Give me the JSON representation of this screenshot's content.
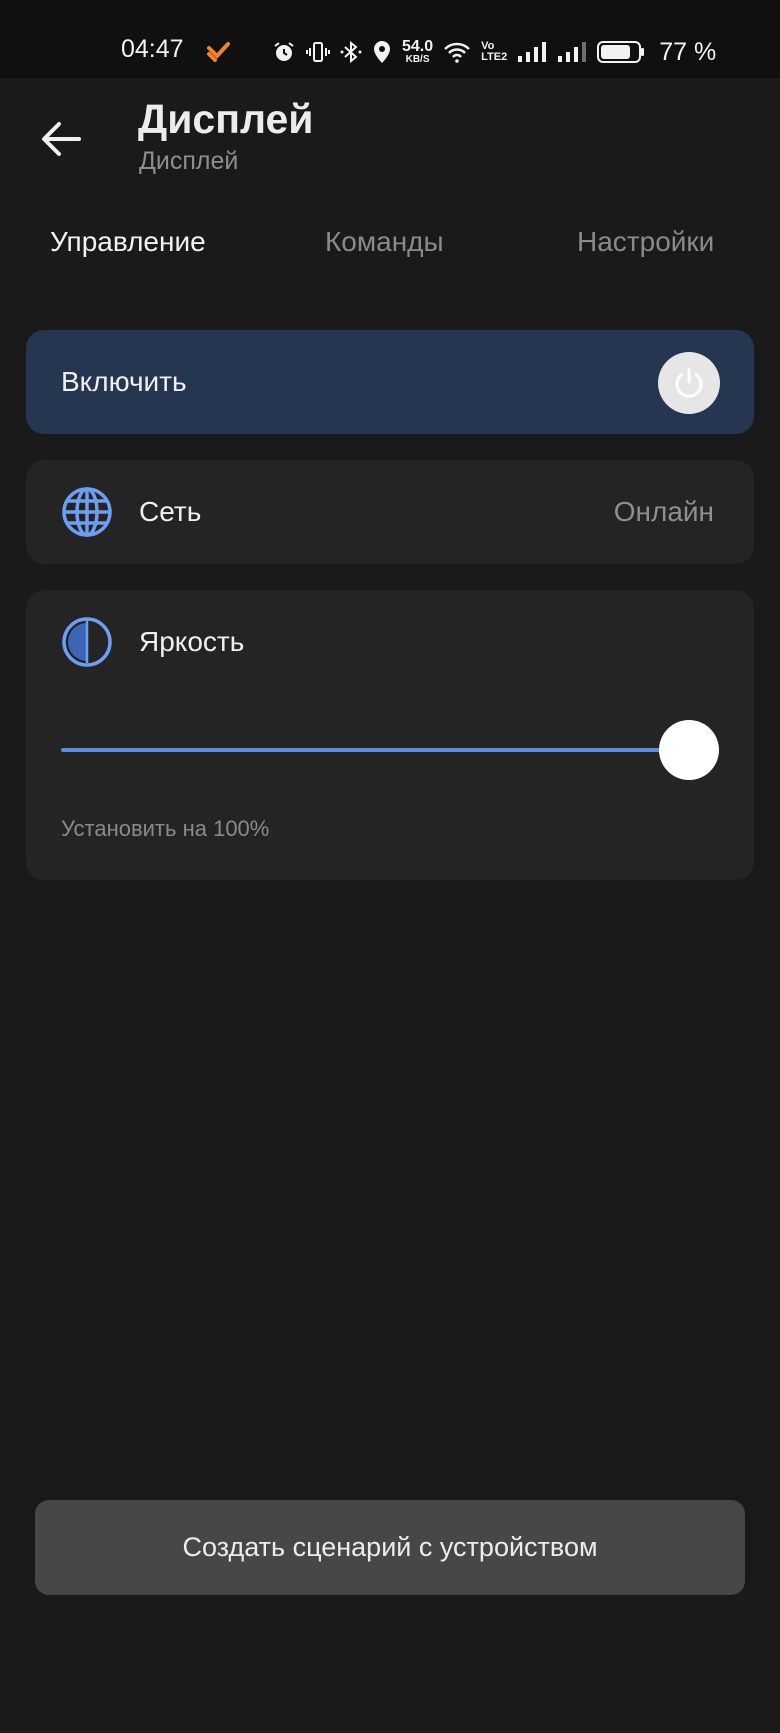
{
  "status_bar": {
    "time": "04:47",
    "net_speed_value": "54.0",
    "net_speed_unit": "KB/S",
    "volte_top": "Vo",
    "volte_bottom": "LTE2",
    "battery_percent": "77 %",
    "icons": [
      "app-notification-icon",
      "alarm-icon",
      "vibrate-icon",
      "bluetooth-icon",
      "location-icon",
      "wifi-icon",
      "signal-icon",
      "signal-icon",
      "battery-icon"
    ],
    "app_icon_color": "#f0822a"
  },
  "header": {
    "title": "Дисплей",
    "subtitle": "Дисплей"
  },
  "tabs": [
    {
      "label": "Управление",
      "active": true
    },
    {
      "label": "Команды",
      "active": false
    },
    {
      "label": "Настройки",
      "active": false
    }
  ],
  "power_card": {
    "label": "Включить",
    "icon": "power-icon"
  },
  "network_card": {
    "label": "Сеть",
    "value": "Онлайн",
    "icon": "globe-icon"
  },
  "brightness_card": {
    "label": "Яркость",
    "icon": "brightness-icon",
    "slider_value_percent": 100,
    "hint": "Установить на 100%"
  },
  "scenario_button": {
    "label": "Создать сценарий с устройством"
  },
  "colors": {
    "background": "#1a1a1a",
    "card": "#242424",
    "power_card": "#263650",
    "accent": "#5b8fdc",
    "button": "#474747"
  }
}
